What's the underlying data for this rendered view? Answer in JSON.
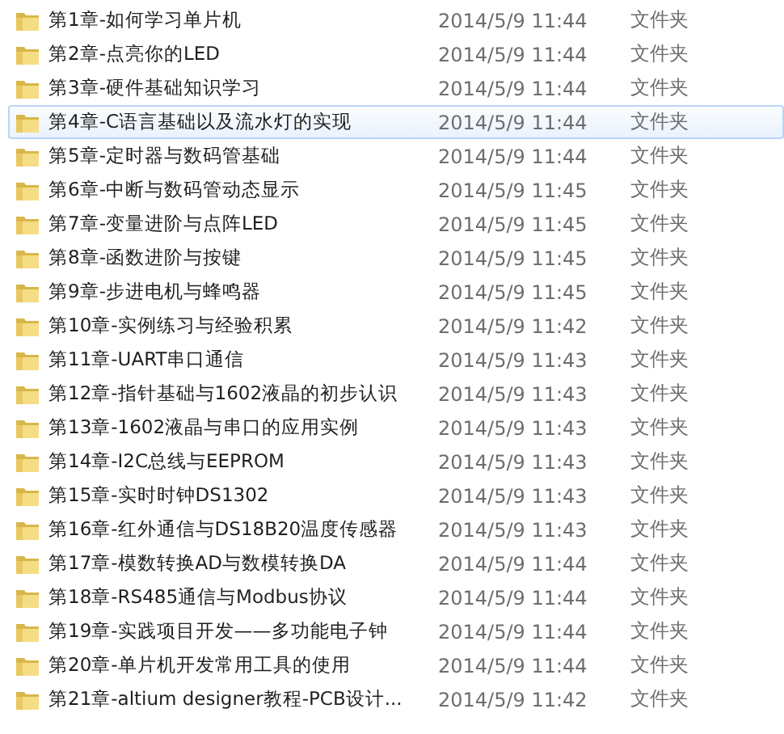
{
  "rows": [
    {
      "name": "第1章-如何学习单片机",
      "date": "2014/5/9 11:44",
      "type": "文件夹",
      "selected": false
    },
    {
      "name": "第2章-点亮你的LED",
      "date": "2014/5/9 11:44",
      "type": "文件夹",
      "selected": false
    },
    {
      "name": "第3章-硬件基础知识学习",
      "date": "2014/5/9 11:44",
      "type": "文件夹",
      "selected": false
    },
    {
      "name": "第4章-C语言基础以及流水灯的实现",
      "date": "2014/5/9 11:44",
      "type": "文件夹",
      "selected": true
    },
    {
      "name": "第5章-定时器与数码管基础",
      "date": "2014/5/9 11:44",
      "type": "文件夹",
      "selected": false
    },
    {
      "name": "第6章-中断与数码管动态显示",
      "date": "2014/5/9 11:45",
      "type": "文件夹",
      "selected": false
    },
    {
      "name": "第7章-变量进阶与点阵LED",
      "date": "2014/5/9 11:45",
      "type": "文件夹",
      "selected": false
    },
    {
      "name": "第8章-函数进阶与按键",
      "date": "2014/5/9 11:45",
      "type": "文件夹",
      "selected": false
    },
    {
      "name": "第9章-步进电机与蜂鸣器",
      "date": "2014/5/9 11:45",
      "type": "文件夹",
      "selected": false
    },
    {
      "name": "第10章-实例练习与经验积累",
      "date": "2014/5/9 11:42",
      "type": "文件夹",
      "selected": false
    },
    {
      "name": "第11章-UART串口通信",
      "date": "2014/5/9 11:43",
      "type": "文件夹",
      "selected": false
    },
    {
      "name": "第12章-指针基础与1602液晶的初步认识",
      "date": "2014/5/9 11:43",
      "type": "文件夹",
      "selected": false
    },
    {
      "name": "第13章-1602液晶与串口的应用实例",
      "date": "2014/5/9 11:43",
      "type": "文件夹",
      "selected": false
    },
    {
      "name": "第14章-I2C总线与EEPROM",
      "date": "2014/5/9 11:43",
      "type": "文件夹",
      "selected": false
    },
    {
      "name": "第15章-实时时钟DS1302",
      "date": "2014/5/9 11:43",
      "type": "文件夹",
      "selected": false
    },
    {
      "name": "第16章-红外通信与DS18B20温度传感器",
      "date": "2014/5/9 11:43",
      "type": "文件夹",
      "selected": false
    },
    {
      "name": "第17章-模数转换AD与数模转换DA",
      "date": "2014/5/9 11:44",
      "type": "文件夹",
      "selected": false
    },
    {
      "name": "第18章-RS485通信与Modbus协议",
      "date": "2014/5/9 11:44",
      "type": "文件夹",
      "selected": false
    },
    {
      "name": "第19章-实践项目开发——多功能电子钟",
      "date": "2014/5/9 11:44",
      "type": "文件夹",
      "selected": false
    },
    {
      "name": "第20章-单片机开发常用工具的使用",
      "date": "2014/5/9 11:44",
      "type": "文件夹",
      "selected": false
    },
    {
      "name": "第21章-altium designer教程-PCB设计...",
      "date": "2014/5/9 11:42",
      "type": "文件夹",
      "selected": false
    }
  ]
}
